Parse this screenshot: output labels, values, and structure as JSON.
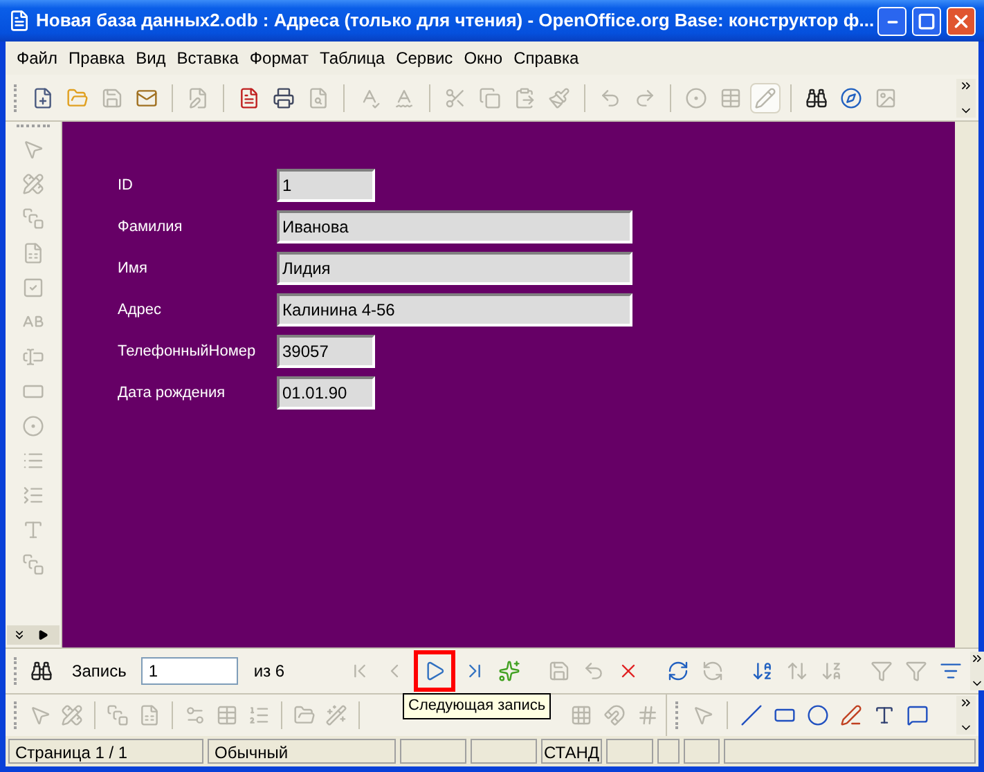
{
  "window": {
    "title": "Новая база данных2.odb : Адреса (только для чтения) - OpenOffice.org Base: конструктор ф..."
  },
  "menu": [
    "Файл",
    "Правка",
    "Вид",
    "Вставка",
    "Формат",
    "Таблица",
    "Сервис",
    "Окно",
    "Справка"
  ],
  "standard_toolbar": [
    {
      "kind": "new",
      "disabled": false
    },
    {
      "kind": "open",
      "disabled": false
    },
    {
      "kind": "save",
      "disabled": true
    },
    {
      "kind": "mail",
      "disabled": false
    },
    {
      "kind": "separator"
    },
    {
      "kind": "edit",
      "disabled": true
    },
    {
      "kind": "separator"
    },
    {
      "kind": "pdf",
      "disabled": false
    },
    {
      "kind": "print",
      "disabled": false
    },
    {
      "kind": "preview",
      "disabled": true
    },
    {
      "kind": "separator"
    },
    {
      "kind": "spell",
      "disabled": true
    },
    {
      "kind": "autospell",
      "disabled": true
    },
    {
      "kind": "separator"
    },
    {
      "kind": "cut",
      "disabled": true
    },
    {
      "kind": "copy",
      "disabled": true
    },
    {
      "kind": "paste",
      "disabled": true
    },
    {
      "kind": "brush",
      "disabled": true
    },
    {
      "kind": "separator"
    },
    {
      "kind": "undo",
      "disabled": true
    },
    {
      "kind": "redo",
      "disabled": true
    },
    {
      "kind": "separator"
    },
    {
      "kind": "navigator",
      "disabled": true
    },
    {
      "kind": "table",
      "disabled": true
    },
    {
      "kind": "draw",
      "disabled": true,
      "selected": true
    },
    {
      "kind": "separator"
    },
    {
      "kind": "find",
      "disabled": false
    },
    {
      "kind": "compass",
      "disabled": false
    },
    {
      "kind": "gallery",
      "disabled": true
    }
  ],
  "controls_toolbar": [
    {
      "kind": "pointer",
      "disabled": true
    },
    {
      "kind": "design",
      "disabled": true
    },
    {
      "kind": "control",
      "disabled": true
    },
    {
      "kind": "form",
      "disabled": true
    },
    {
      "kind": "checkbox",
      "disabled": true
    },
    {
      "kind": "label",
      "disabled": true
    },
    {
      "kind": "field",
      "disabled": true
    },
    {
      "kind": "pushbutton",
      "disabled": true
    },
    {
      "kind": "radio",
      "disabled": true
    },
    {
      "kind": "listbox",
      "disabled": true
    },
    {
      "kind": "combobox",
      "disabled": true
    },
    {
      "kind": "text",
      "disabled": true
    },
    {
      "kind": "more",
      "disabled": true
    }
  ],
  "form": {
    "fields": [
      {
        "label": "ID",
        "value": "1",
        "kind": "short"
      },
      {
        "label": "Фамилия",
        "value": "Иванова",
        "kind": "long"
      },
      {
        "label": "Имя",
        "value": "Лидия",
        "kind": "long"
      },
      {
        "label": "Адрес",
        "value": "Калинина 4-56",
        "kind": "long"
      },
      {
        "label": "ТелефонныйНомер",
        "value": "39057",
        "kind": "short"
      },
      {
        "label": "Дата рождения",
        "value": "01.01.90",
        "kind": "short"
      }
    ]
  },
  "navigation": {
    "search": {
      "kind": "find",
      "disabled": false
    },
    "label": "Запись",
    "record": "1",
    "total": "из 6",
    "buttons": [
      {
        "kind": "first",
        "disabled": true,
        "highlighted": false
      },
      {
        "kind": "prev",
        "disabled": true,
        "highlighted": false
      },
      {
        "kind": "next",
        "disabled": false,
        "highlighted": true
      },
      {
        "kind": "last",
        "disabled": false,
        "highlighted": false
      },
      {
        "kind": "newrecord",
        "disabled": false,
        "highlighted": false
      },
      {
        "kind": "separator"
      },
      {
        "kind": "save",
        "disabled": true,
        "highlighted": false
      },
      {
        "kind": "undo",
        "disabled": true,
        "highlighted": false
      },
      {
        "kind": "delete",
        "disabled": false,
        "highlighted": false
      },
      {
        "kind": "separator"
      },
      {
        "kind": "refresh",
        "disabled": false,
        "highlighted": false
      },
      {
        "kind": "refresh2",
        "disabled": true,
        "highlighted": false
      },
      {
        "kind": "separator"
      },
      {
        "kind": "sortasc",
        "disabled": false,
        "highlighted": false
      },
      {
        "kind": "sort",
        "disabled": true,
        "highlighted": false
      },
      {
        "kind": "sortdesc",
        "disabled": true,
        "highlighted": false
      },
      {
        "kind": "separator"
      },
      {
        "kind": "autofilter",
        "disabled": true,
        "highlighted": false
      },
      {
        "kind": "filter",
        "disabled": true,
        "highlighted": false
      },
      {
        "kind": "filternav",
        "disabled": false,
        "highlighted": false
      }
    ],
    "tooltip": "Следующая запись"
  },
  "design_toolbar": [
    {
      "kind": "pointer",
      "disabled": true
    },
    {
      "kind": "design",
      "disabled": true
    },
    {
      "kind": "separator"
    },
    {
      "kind": "control",
      "disabled": true
    },
    {
      "kind": "form",
      "disabled": true
    },
    {
      "kind": "separator"
    },
    {
      "kind": "properties",
      "disabled": true
    },
    {
      "kind": "table",
      "disabled": true
    },
    {
      "kind": "order",
      "disabled": true
    },
    {
      "kind": "separator"
    },
    {
      "kind": "open",
      "disabled": true
    },
    {
      "kind": "wizard",
      "disabled": true
    },
    {
      "kind": "separator"
    },
    {
      "kind": "grid",
      "disabled": true
    },
    {
      "kind": "snap",
      "disabled": true
    },
    {
      "kind": "helplines",
      "disabled": true
    }
  ],
  "drawing_toolbar": [
    {
      "kind": "pointer",
      "disabled": true
    },
    {
      "kind": "separator"
    },
    {
      "kind": "line",
      "disabled": false
    },
    {
      "kind": "rect",
      "disabled": false
    },
    {
      "kind": "ellipse",
      "disabled": false
    },
    {
      "kind": "pen",
      "disabled": false
    },
    {
      "kind": "text",
      "disabled": false
    },
    {
      "kind": "callout",
      "disabled": false
    }
  ],
  "status_bar": {
    "page": "Страница  1 / 1",
    "style": "Обычный",
    "mode": "СТАНД"
  }
}
